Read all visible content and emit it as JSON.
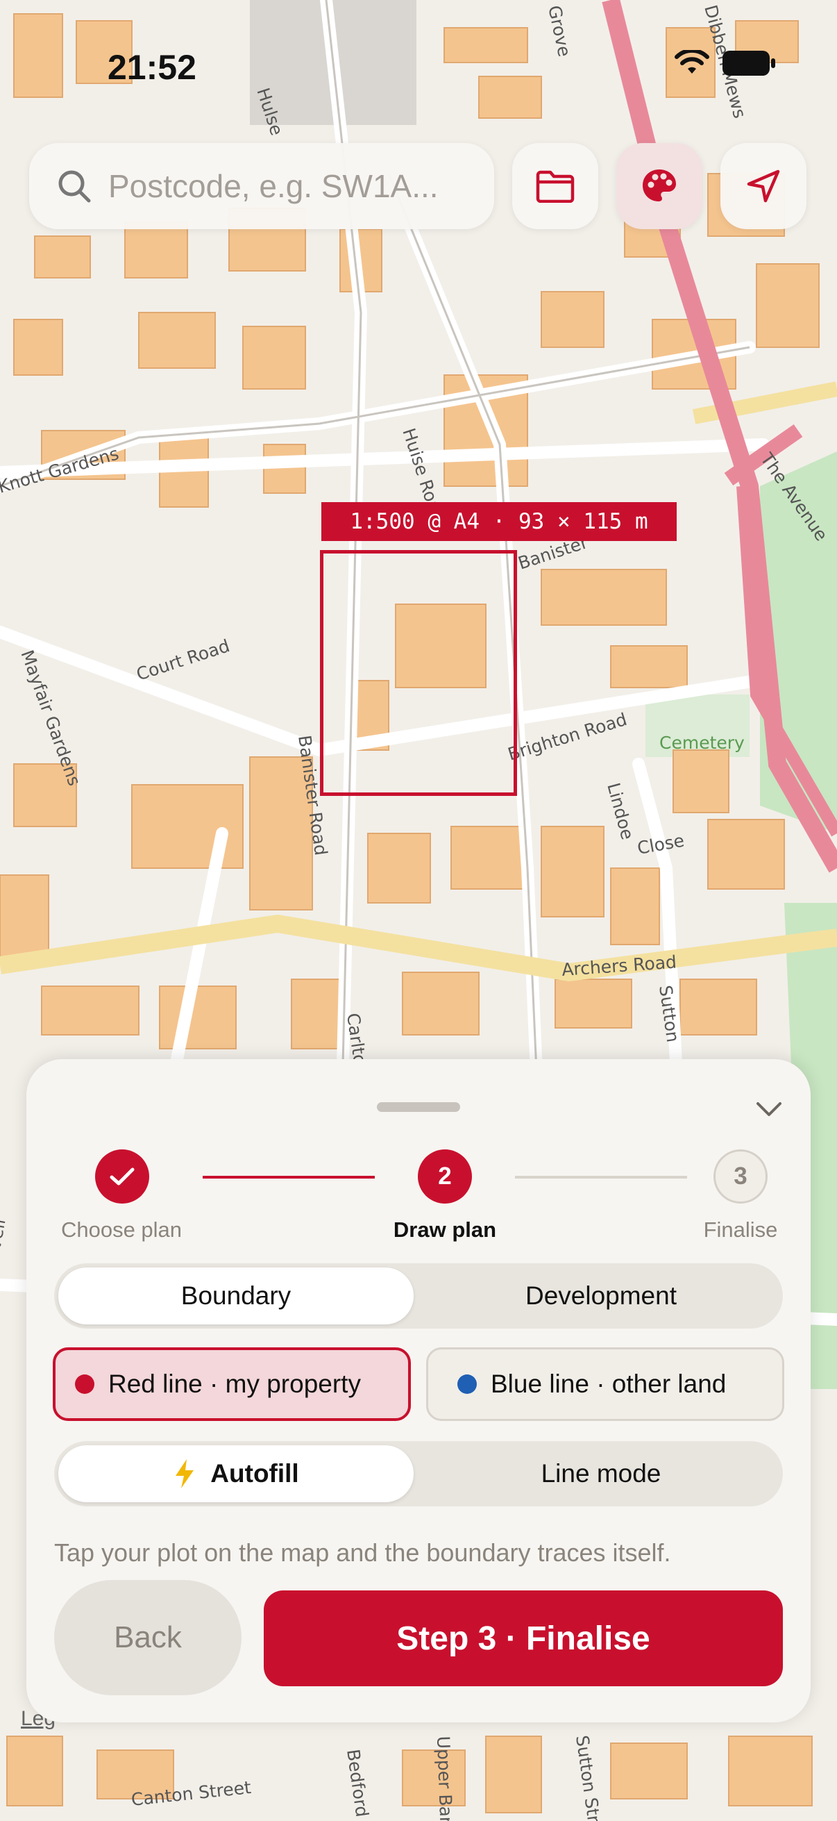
{
  "status": {
    "time": "21:52"
  },
  "search": {
    "placeholder": "Postcode, e.g. SW1A..."
  },
  "toolbar": {
    "folder_icon": "folder-icon",
    "palette_icon": "palette-icon",
    "locate_icon": "navigation-arrow-icon"
  },
  "map": {
    "scale_label": "1:500 @ A4 · 93 × 115 m",
    "streets": [
      "Court Road",
      "Mayfair Gardens",
      "Banister Road",
      "Banister",
      "Brighton Road",
      "Huise Road",
      "Hulse",
      "Archers Road",
      "Lindoe",
      "Close",
      "Sutton",
      "The Avenue",
      "Cemetery",
      "Canton Street",
      "Bedford",
      "Upper Banist",
      "Sutton Street",
      "Dibben Mews",
      "Grove",
      "Knott Gardens",
      "Carlton",
      "vell"
    ],
    "legend_fragment": "Leg"
  },
  "colors": {
    "accent": "#c8102e",
    "blue_line": "#1f5fb4"
  },
  "sheet": {
    "steps": [
      {
        "number": "1",
        "label": "Choose plan",
        "state": "done"
      },
      {
        "number": "2",
        "label": "Draw plan",
        "state": "current"
      },
      {
        "number": "3",
        "label": "Finalise",
        "state": "todo"
      }
    ],
    "layer_tabs": [
      {
        "label": "Boundary",
        "selected": true
      },
      {
        "label": "Development",
        "selected": false
      }
    ],
    "line_types": [
      {
        "label": "Red line · my property",
        "color": "#c8102e",
        "selected": true
      },
      {
        "label": "Blue line · other land",
        "color": "#1f5fb4",
        "selected": false
      }
    ],
    "modes": [
      {
        "label": "Autofill",
        "icon": "lightning-icon",
        "selected": true
      },
      {
        "label": "Line mode",
        "selected": false
      }
    ],
    "hint": "Tap your plot on the map and the boundary traces itself.",
    "back_label": "Back",
    "next_label": "Step 3 · Finalise"
  }
}
